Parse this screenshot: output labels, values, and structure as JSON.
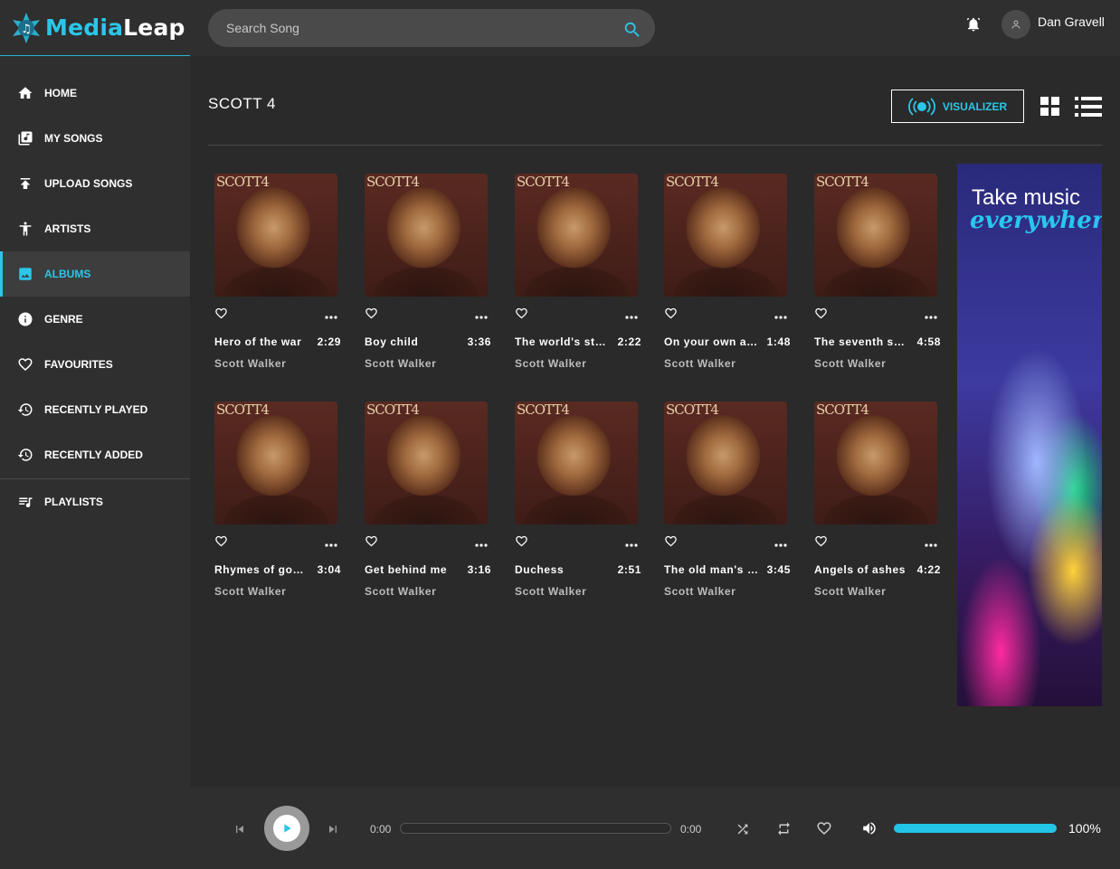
{
  "brand": {
    "part1": "Media",
    "part2": "Leap"
  },
  "search": {
    "placeholder": "Search Song"
  },
  "user": {
    "name": "Dan Gravell"
  },
  "nav": {
    "items": [
      {
        "label": "HOME",
        "icon": "home-icon"
      },
      {
        "label": "MY SONGS",
        "icon": "library-music-icon"
      },
      {
        "label": "UPLOAD SONGS",
        "icon": "upload-icon"
      },
      {
        "label": "ARTISTS",
        "icon": "person-icon"
      },
      {
        "label": "ALBUMS",
        "icon": "album-image-icon",
        "active": true
      },
      {
        "label": "GENRE",
        "icon": "info-icon"
      },
      {
        "label": "FAVOURITES",
        "icon": "heart-icon"
      },
      {
        "label": "RECENTLY PLAYED",
        "icon": "history-icon"
      },
      {
        "label": "RECENTLY ADDED",
        "icon": "history-icon"
      },
      {
        "label": "PLAYLISTS",
        "icon": "playlist-icon"
      }
    ]
  },
  "album": {
    "title": "SCOTT 4",
    "visualizer_label": "VISUALIZER",
    "cover_text": "SCOTT4",
    "songs": [
      {
        "name": "Hero of the war",
        "duration": "2:29",
        "artist": "Scott Walker"
      },
      {
        "name": "Boy child",
        "duration": "3:36",
        "artist": "Scott Walker"
      },
      {
        "name": "The world's strong",
        "duration": "2:22",
        "artist": "Scott Walker"
      },
      {
        "name": "On your own again",
        "duration": "1:48",
        "artist": "Scott Walker"
      },
      {
        "name": "The seventh seal",
        "duration": "4:58",
        "artist": "Scott Walker"
      },
      {
        "name": "Rhymes of goodbye",
        "duration": "3:04",
        "artist": "Scott Walker"
      },
      {
        "name": "Get behind me",
        "duration": "3:16",
        "artist": "Scott Walker"
      },
      {
        "name": "Duchess",
        "duration": "2:51",
        "artist": "Scott Walker"
      },
      {
        "name": "The old man's back again",
        "duration": "3:45",
        "artist": "Scott Walker"
      },
      {
        "name": "Angels of ashes",
        "duration": "4:22",
        "artist": "Scott Walker"
      }
    ]
  },
  "ad": {
    "line1": "Take music",
    "line2": "everywhere"
  },
  "player": {
    "current_time": "0:00",
    "total_time": "0:00",
    "progress": 0,
    "volume_label": "100%",
    "volume": 1.0
  },
  "colors": {
    "accent": "#2bc6e8",
    "sidebar_bg": "#2f2f2f",
    "main_bg": "#2a2a2a"
  }
}
